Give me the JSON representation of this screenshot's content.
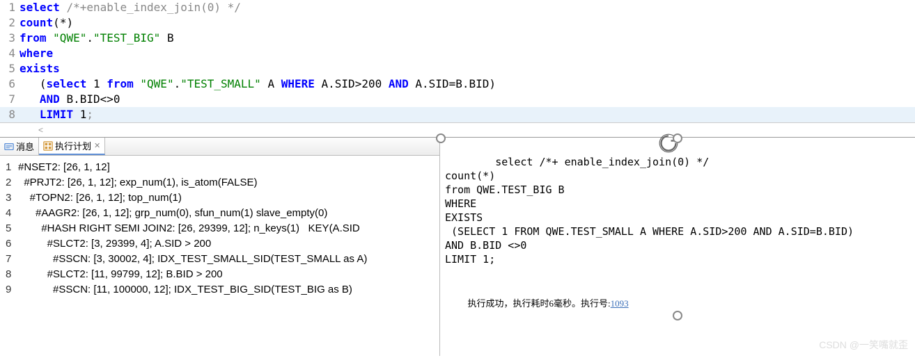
{
  "editor": {
    "lines": [
      {
        "n": "1",
        "tokens": [
          {
            "t": "select",
            "c": "kw"
          },
          {
            "t": " ",
            "c": "plain"
          },
          {
            "t": "/*+enable_index_join(0) */",
            "c": "cm"
          }
        ]
      },
      {
        "n": "2",
        "tokens": [
          {
            "t": "count",
            "c": "fn"
          },
          {
            "t": "(",
            "c": "paren"
          },
          {
            "t": "*",
            "c": "plain"
          },
          {
            "t": ")",
            "c": "paren"
          }
        ]
      },
      {
        "n": "3",
        "tokens": [
          {
            "t": "from",
            "c": "kw"
          },
          {
            "t": " ",
            "c": "plain"
          },
          {
            "t": "\"QWE\"",
            "c": "str"
          },
          {
            "t": ".",
            "c": "plain"
          },
          {
            "t": "\"TEST_BIG\"",
            "c": "str"
          },
          {
            "t": " B",
            "c": "plain"
          }
        ]
      },
      {
        "n": "4",
        "tokens": [
          {
            "t": "where",
            "c": "kw"
          }
        ]
      },
      {
        "n": "5",
        "tokens": [
          {
            "t": "exists",
            "c": "kw"
          }
        ]
      },
      {
        "n": "6",
        "tokens": [
          {
            "t": "   (",
            "c": "plain"
          },
          {
            "t": "select",
            "c": "kw"
          },
          {
            "t": " 1 ",
            "c": "plain"
          },
          {
            "t": "from",
            "c": "kw"
          },
          {
            "t": " ",
            "c": "plain"
          },
          {
            "t": "\"QWE\"",
            "c": "str"
          },
          {
            "t": ".",
            "c": "plain"
          },
          {
            "t": "\"TEST_SMALL\"",
            "c": "str"
          },
          {
            "t": " A ",
            "c": "plain"
          },
          {
            "t": "WHERE",
            "c": "kw"
          },
          {
            "t": " A.SID>200 ",
            "c": "plain"
          },
          {
            "t": "AND",
            "c": "kw"
          },
          {
            "t": " A.SID=B.BID)",
            "c": "plain"
          }
        ]
      },
      {
        "n": "7",
        "tokens": [
          {
            "t": "   ",
            "c": "plain"
          },
          {
            "t": "AND",
            "c": "kw"
          },
          {
            "t": " B.BID<>0",
            "c": "plain"
          }
        ]
      },
      {
        "n": "8",
        "tokens": [
          {
            "t": "   ",
            "c": "plain"
          },
          {
            "t": "LIMIT",
            "c": "kw"
          },
          {
            "t": " 1",
            "c": "plain"
          },
          {
            "t": ";",
            "c": "cm"
          }
        ],
        "hl": true
      }
    ]
  },
  "tabs": {
    "messages": "消息",
    "plan": "执行计划"
  },
  "plan": {
    "lines": [
      {
        "n": "1",
        "t": "#NSET2: [26, 1, 12]"
      },
      {
        "n": "2",
        "t": "  #PRJT2: [26, 1, 12]; exp_num(1), is_atom(FALSE)"
      },
      {
        "n": "3",
        "t": "    #TOPN2: [26, 1, 12]; top_num(1)"
      },
      {
        "n": "4",
        "t": "      #AAGR2: [26, 1, 12]; grp_num(0), sfun_num(1) slave_empty(0)"
      },
      {
        "n": "5",
        "t": "        #HASH RIGHT SEMI JOIN2: [26, 29399, 12]; n_keys(1)   KEY(A.SID"
      },
      {
        "n": "6",
        "t": "          #SLCT2: [3, 29399, 4]; A.SID > 200"
      },
      {
        "n": "7",
        "t": "            #SSCN: [3, 30002, 4]; IDX_TEST_SMALL_SID(TEST_SMALL as A)"
      },
      {
        "n": "8",
        "t": "          #SLCT2: [11, 99799, 12]; B.BID > 200"
      },
      {
        "n": "9",
        "t": "            #SSCN: [11, 100000, 12]; IDX_TEST_BIG_SID(TEST_BIG as B)"
      }
    ]
  },
  "result": {
    "sql": "select /*+ enable_index_join(0) */\ncount(*)\nfrom QWE.TEST_BIG B\nWHERE\nEXISTS\n (SELECT 1 FROM QWE.TEST_SMALL A WHERE A.SID>200 AND A.SID=B.BID)\nAND B.BID <>0\nLIMIT 1;",
    "status_prefix": "执行成功，执行耗时6毫秒。执行号:",
    "exec_id": "1093"
  },
  "watermark": "CSDN @一笑嘴就歪"
}
